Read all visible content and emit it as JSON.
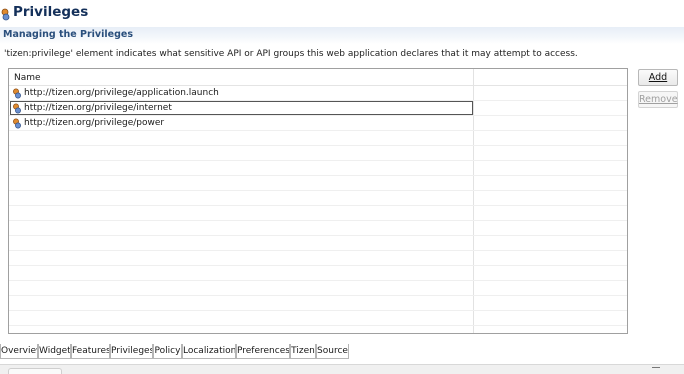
{
  "header": {
    "title": "Privileges",
    "icon": "privilege-key-icon"
  },
  "section": {
    "title": "Managing the Privileges"
  },
  "description": "'tizen:privilege' element indicates what sensitive API or API groups this web application declares that it may attempt to access.",
  "table": {
    "columns": [
      "Name",
      ""
    ],
    "rows": [
      {
        "name": "http://tizen.org/privilege/application.launch",
        "icon": "privilege-icon",
        "selected": false
      },
      {
        "name": "http://tizen.org/privilege/internet",
        "icon": "privilege-icon",
        "selected": true
      },
      {
        "name": "http://tizen.org/privilege/power",
        "icon": "privilege-icon",
        "selected": false
      }
    ],
    "empty_rows": 13
  },
  "buttons": {
    "add_label": "Add",
    "remove_label": "Remove",
    "remove_enabled": false
  },
  "tabs": [
    {
      "label": "Overview",
      "active": false
    },
    {
      "label": "Widget",
      "active": false
    },
    {
      "label": "Features",
      "active": false
    },
    {
      "label": "Privileges",
      "active": true
    },
    {
      "label": "Policy",
      "active": false
    },
    {
      "label": "Localization",
      "active": false
    },
    {
      "label": "Preferences",
      "active": false
    },
    {
      "label": "Tizen",
      "active": false
    },
    {
      "label": "Source",
      "active": false
    }
  ],
  "colors": {
    "title": "#14305a",
    "section_title": "#2a4f7c",
    "disabled_text": "#a0a0a0"
  }
}
